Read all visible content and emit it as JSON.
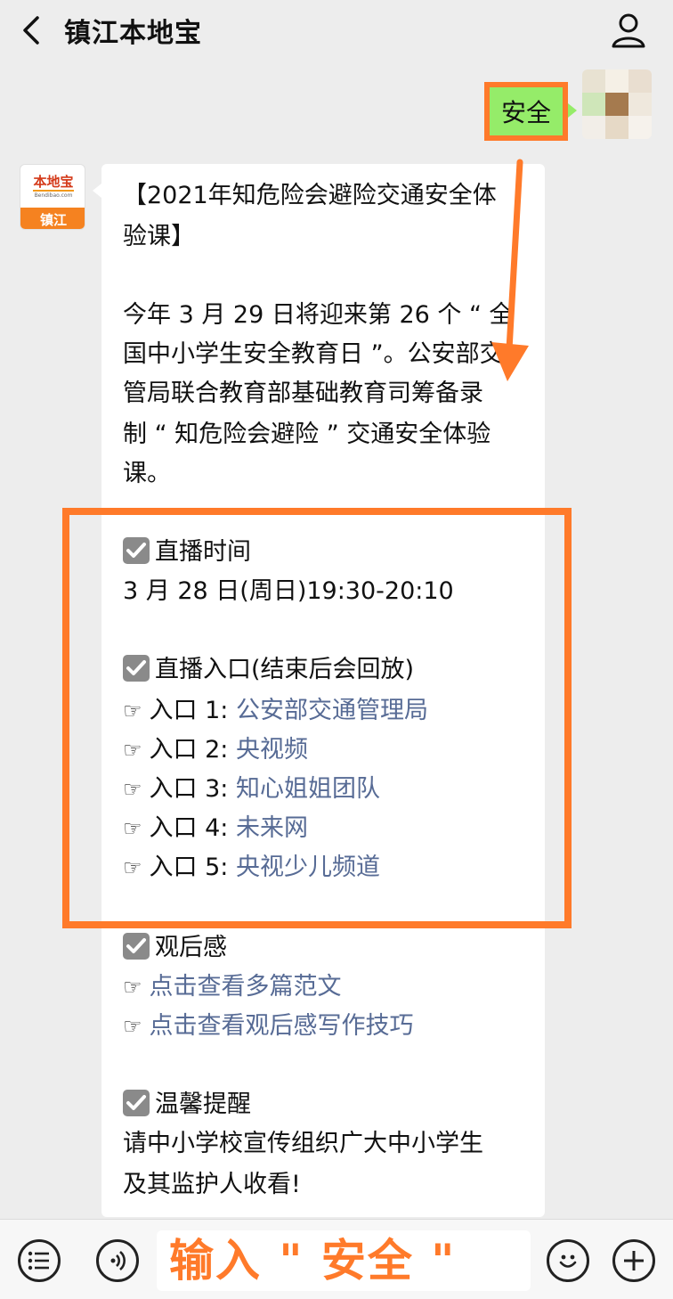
{
  "header": {
    "title": "镇江本地宝",
    "back_icon": "chevron-left-icon",
    "profile_icon": "person-icon"
  },
  "sent_message": {
    "text": "安全"
  },
  "bot": {
    "avatar_top": "本地宝",
    "avatar_sub": "Bendibao.com",
    "avatar_bottom": "镇江"
  },
  "message": {
    "title_line1": "【2021年知危险会避险交通安全体",
    "title_line2": "验课】",
    "intro_lines": [
      "今年 3 月 29 日将迎来第 26 个 “ 全",
      "国中小学生安全教育日 ”。公安部交",
      "管局联合教育部基础教育司筹备录",
      "制 “ 知危险会避险 ” 交通安全体验",
      "课。"
    ],
    "broadcast_time_heading": "直播时间",
    "broadcast_time": "3 月 28 日(周日)19:30-20:10",
    "entry_heading": "直播入口(结束后会回放)",
    "hand_icon": "☞",
    "entries": [
      {
        "label": "入口 1: ",
        "link": "公安部交通管理局"
      },
      {
        "label": "入口 2: ",
        "link": "央视频"
      },
      {
        "label": "入口 3: ",
        "link": "知心姐姐团队"
      },
      {
        "label": "入口 4: ",
        "link": "未来网"
      },
      {
        "label": "入口 5: ",
        "link": "央视少儿频道"
      }
    ],
    "review_heading": "观后感",
    "review_links": [
      "点击查看多篇范文",
      "点击查看观后感写作技巧"
    ],
    "reminder_heading": "温馨提醒",
    "reminder_lines": [
      "请中小学校宣传组织广大中小学生",
      "及其监护人收看!"
    ]
  },
  "bottom_bar": {
    "menu_icon": "list-menu-icon",
    "voice_icon": "voice-icon",
    "input_text": "输入 \" 安全 \"",
    "emoji_icon": "emoji-icon",
    "plus_icon": "plus-icon"
  },
  "colors": {
    "accent_orange": "#ff7a2a",
    "link_blue": "#576b95",
    "bubble_green": "#95ec69",
    "background": "#ededed"
  }
}
